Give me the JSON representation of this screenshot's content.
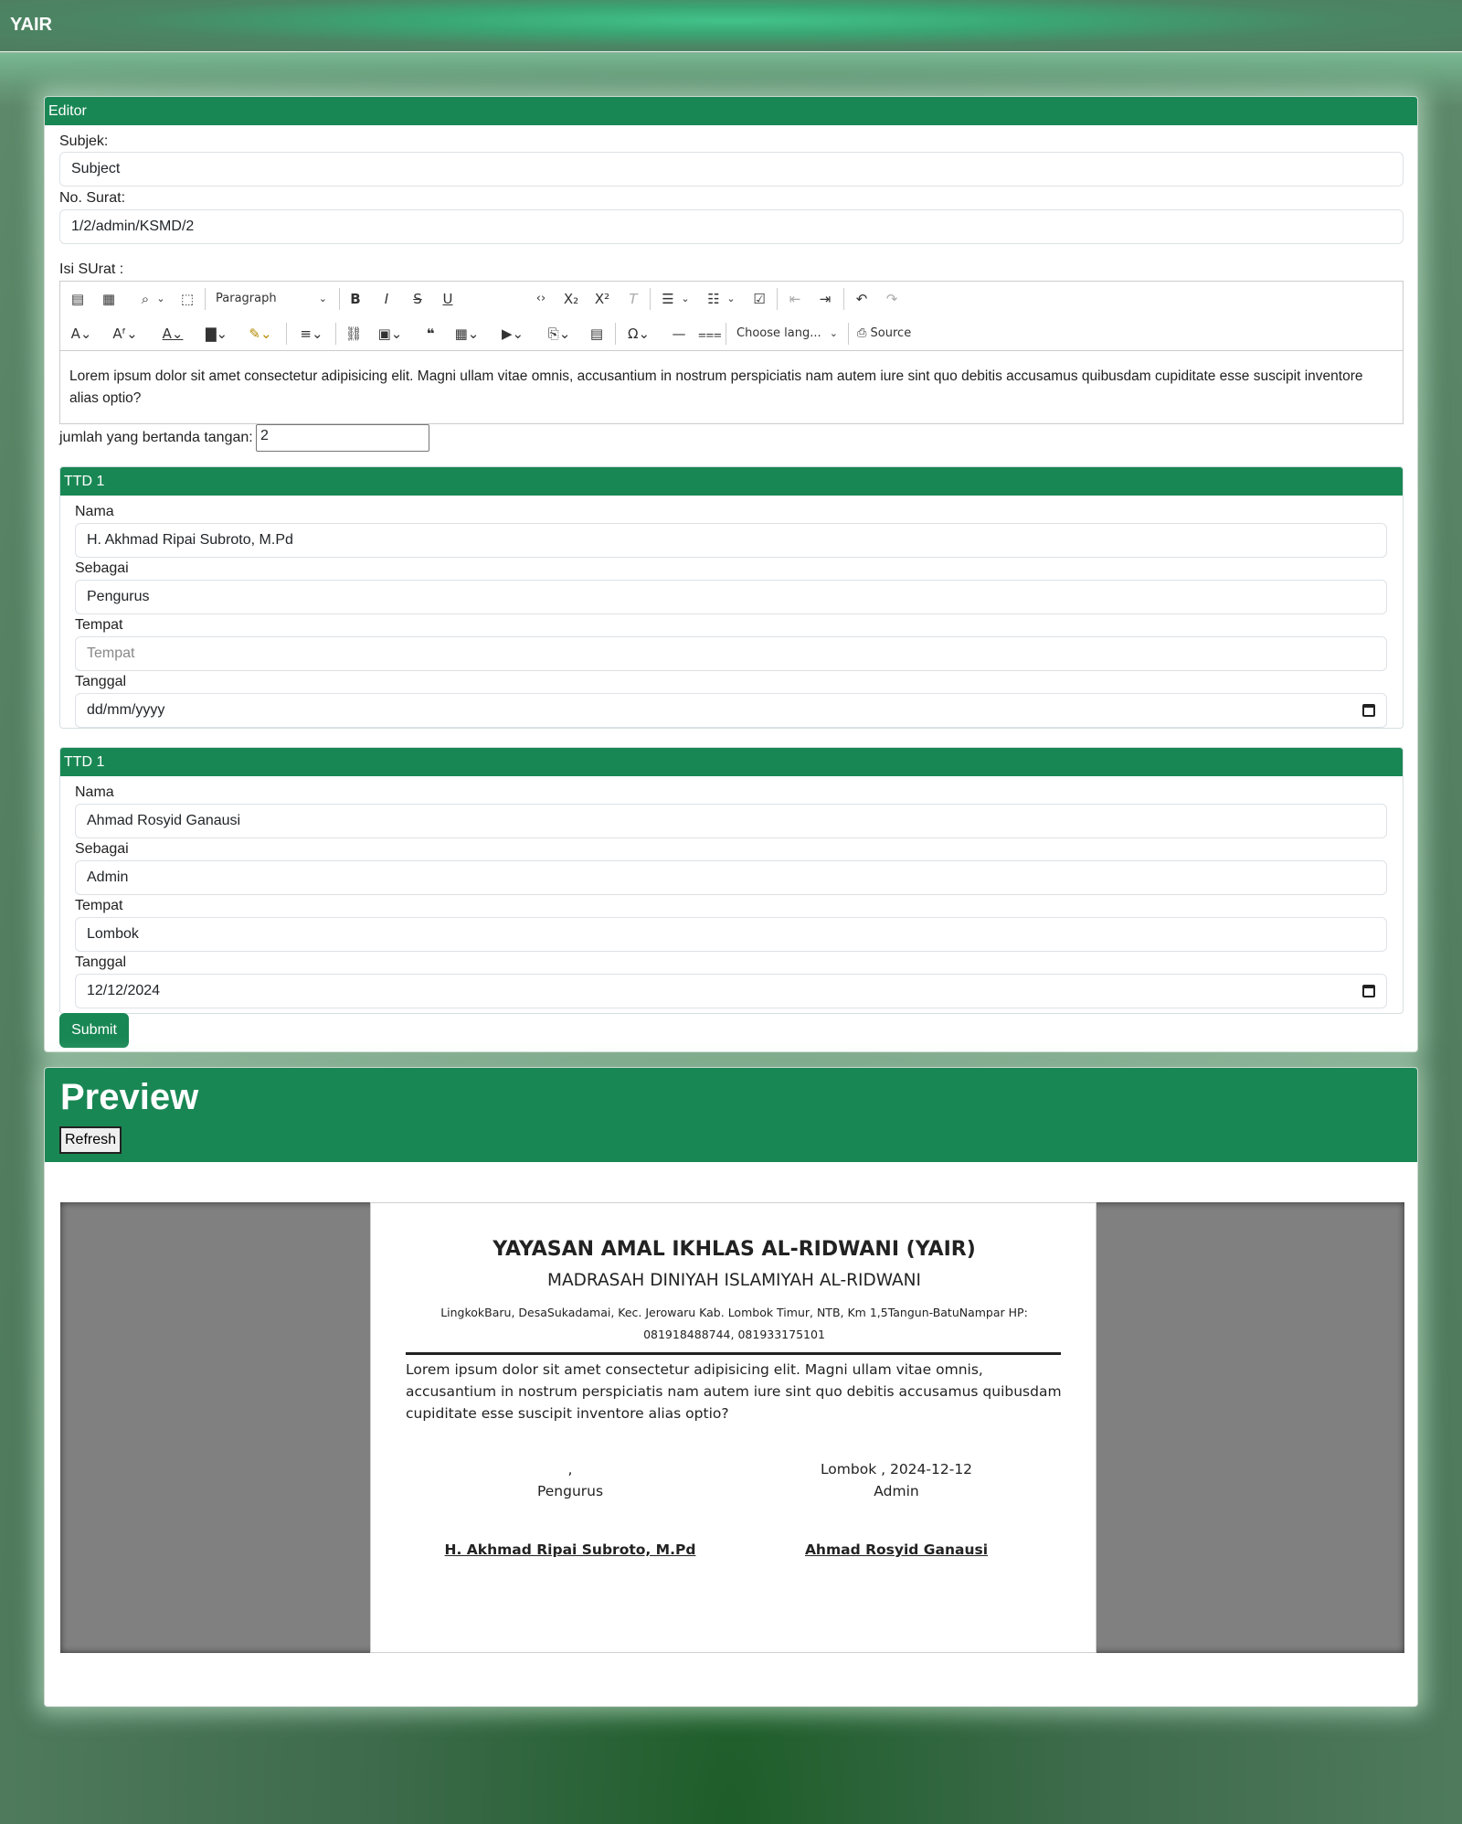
{
  "app": {
    "brand": "YAIR"
  },
  "editor": {
    "header": "Editor",
    "subject_label": "Subjek:",
    "subject_value": "Subject",
    "number_label": "No. Surat:",
    "number_value": "1/2/admin/KSMD/2",
    "content_label": "Isi SUrat :",
    "toolbar": {
      "paragraph_select": "Paragraph",
      "language_select": "Choose lang...",
      "source_label": "Source",
      "icons": [
        "export-pdf-icon",
        "export-word-icon",
        "find-replace-icon",
        "select-all-icon",
        "bold-icon",
        "italic-icon",
        "strikethrough-icon",
        "underline-icon",
        "code-icon",
        "subscript-icon",
        "superscript-icon",
        "remove-format-icon",
        "bulleted-list-icon",
        "numbered-list-icon",
        "todo-list-icon",
        "outdent-icon",
        "indent-icon",
        "undo-icon",
        "redo-icon",
        "font-size-icon",
        "font-family-icon",
        "font-color-icon",
        "background-color-icon",
        "highlight-icon",
        "alignment-icon",
        "link-icon",
        "image-icon",
        "blockquote-icon",
        "table-icon",
        "media-icon",
        "html-embed-icon",
        "page-break-icon",
        "special-chars-icon",
        "horizontal-line-icon",
        "page-break-line-icon",
        "source-icon"
      ]
    },
    "content_text": "Lorem ipsum dolor sit amet consectetur adipisicing elit. Magni ullam vitae omnis, accusantium in nostrum perspiciatis nam autem iure sint quo debitis accusamus quibusdam cupiditate esse suscipit inventore alias optio?",
    "signers_label": "jumlah yang bertanda tangan:",
    "signers_value": "2",
    "ttd": [
      {
        "header": "TTD 1",
        "nama_label": "Nama",
        "nama_value": "H. Akhmad Ripai Subroto, M.Pd",
        "sebagai_label": "Sebagai",
        "sebagai_value": "Pengurus",
        "tempat_label": "Tempat",
        "tempat_placeholder": "Tempat",
        "tanggal_label": "Tanggal",
        "tanggal_value": "dd/mm/yyyy"
      },
      {
        "header": "TTD 1",
        "nama_label": "Nama",
        "nama_value": "Ahmad Rosyid Ganausi",
        "sebagai_label": "Sebagai",
        "sebagai_value": "Admin",
        "tempat_label": "Tempat",
        "tempat_value": "Lombok",
        "tanggal_label": "Tanggal",
        "tanggal_value": "12/12/2024"
      }
    ],
    "submit_label": "Submit"
  },
  "preview": {
    "title": "Preview",
    "refresh_label": "Refresh",
    "letter": {
      "org": "YAYASAN AMAL IKHLAS AL-RIDWANI (YAIR)",
      "school": "MADRASAH DINIYAH ISLAMIYAH AL-RIDWANI",
      "address_line1": "LingkokBaru, DesaSukadamai, Kec. Jerowaru Kab. Lombok Timur, NTB, Km 1,5Tangun-BatuNampar HP:",
      "address_line2": "081918488744, 081933175101",
      "body": "Lorem ipsum dolor sit amet consectetur adipisicing elit. Magni ullam vitae omnis, accusantium in nostrum perspiciatis nam autem iure sint quo debitis accusamus quibusdam cupiditate esse suscipit inventore alias optio?",
      "sig1_place_date": ",",
      "sig1_role": "Pengurus",
      "sig1_name": "H. Akhmad Ripai Subroto, M.Pd",
      "sig2_place_date": "Lombok , 2024-12-12",
      "sig2_role": "Admin",
      "sig2_name": "Ahmad Rosyid Ganausi"
    }
  },
  "colors": {
    "primary": "#198754",
    "viewer_bg": "#808080"
  }
}
